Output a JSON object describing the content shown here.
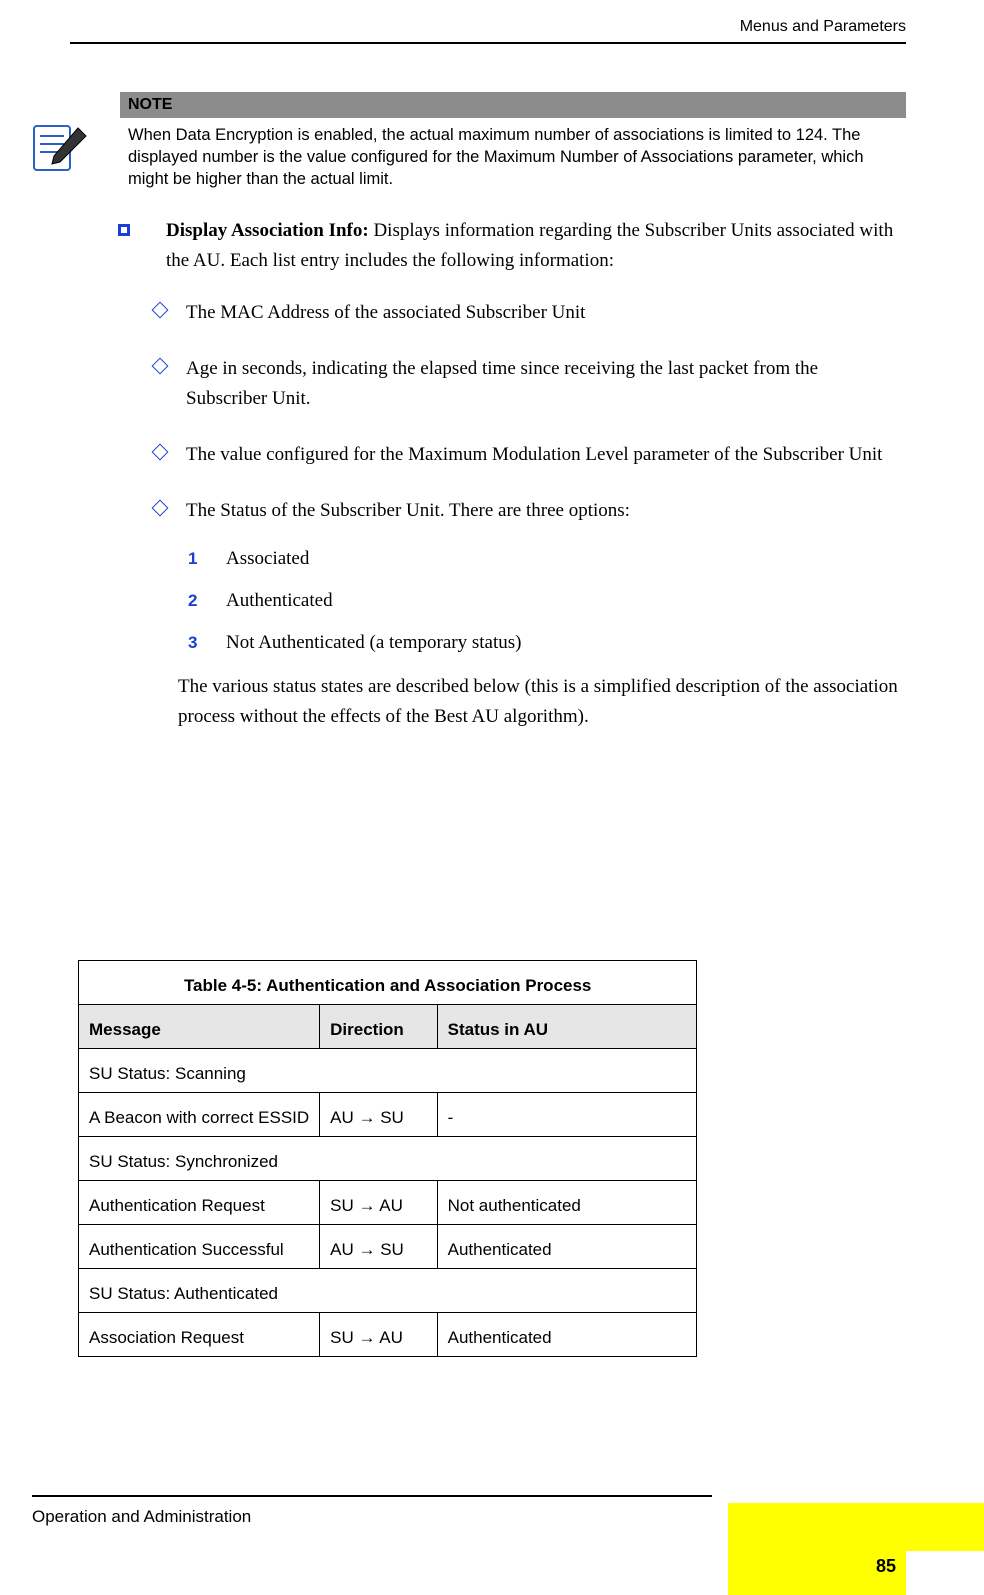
{
  "header": {
    "section": "Menus and Parameters"
  },
  "note": {
    "label": "NOTE",
    "text": "When Data Encryption is enabled, the actual maximum number of associations is limited to 124. The displayed number is the value configured for the Maximum Number of Associations parameter, which might be higher than the actual limit."
  },
  "main_item": {
    "title": "Display Association Info:",
    "desc": " Displays information regarding the Subscriber Units associated with the AU. Each list entry includes the following information:"
  },
  "sub_items": [
    "The MAC Address of the associated Subscriber Unit",
    "Age in seconds, indicating the elapsed time since receiving the last packet from the Subscriber Unit.",
    "The value configured for the Maximum Modulation Level parameter of the Subscriber Unit",
    "The Status of the Subscriber Unit. There are three options:"
  ],
  "status_options": [
    {
      "n": "1",
      "t": "Associated"
    },
    {
      "n": "2",
      "t": "Authenticated"
    },
    {
      "n": "3",
      "t": "Not Authenticated (a temporary status)"
    }
  ],
  "followup": "The various status states are described below (this is a simplified description of the association process without the effects of the Best AU algorithm).",
  "table": {
    "caption": "Table 4-5: Authentication and Association Process",
    "headers": {
      "c1": "Message",
      "c2": "Direction",
      "c3": "Status in AU"
    },
    "rows": [
      {
        "type": "span",
        "c1": "SU Status: Scanning"
      },
      {
        "type": "row",
        "c1": "A Beacon with correct ESSID",
        "c2": "AU  → SU",
        "c3": "-"
      },
      {
        "type": "span",
        "c1": "SU Status: Synchronized"
      },
      {
        "type": "row",
        "c1": "Authentication Request",
        "c2": "SU  → AU",
        "c3": "Not authenticated"
      },
      {
        "type": "row",
        "c1": "Authentication Successful",
        "c2": "AU  → SU",
        "c3": "Authenticated"
      },
      {
        "type": "span",
        "c1": "SU Status: Authenticated"
      },
      {
        "type": "row",
        "c1": "Association Request",
        "c2": "SU  → AU",
        "c3": "Authenticated"
      }
    ]
  },
  "footer": {
    "text": "Operation and Administration",
    "page": "85"
  }
}
